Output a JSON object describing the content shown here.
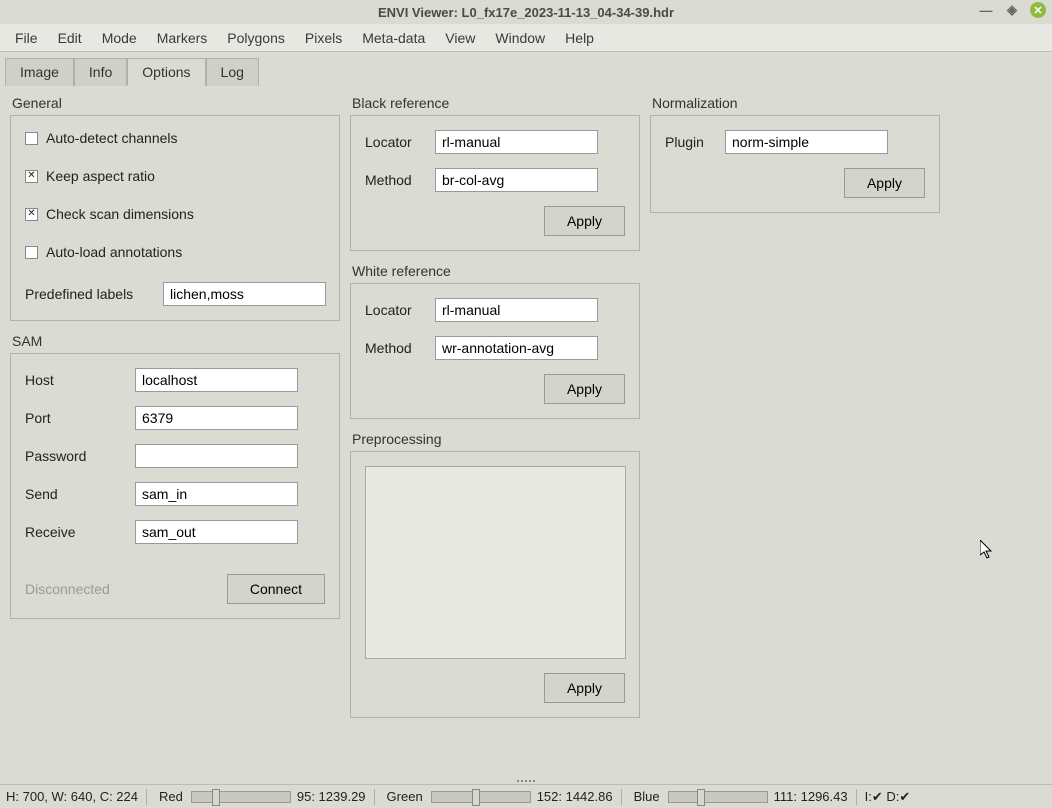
{
  "window": {
    "title": "ENVI Viewer: L0_fx17e_2023-11-13_04-34-39.hdr"
  },
  "menu": [
    "File",
    "Edit",
    "Mode",
    "Markers",
    "Polygons",
    "Pixels",
    "Meta-data",
    "View",
    "Window",
    "Help"
  ],
  "tabs": {
    "image": "Image",
    "info": "Info",
    "options": "Options",
    "log": "Log",
    "active": "options"
  },
  "general": {
    "title": "General",
    "auto_detect": {
      "label": "Auto-detect channels",
      "checked": false
    },
    "aspect": {
      "label": "Keep aspect ratio",
      "checked": true
    },
    "scan": {
      "label": "Check scan dimensions",
      "checked": true
    },
    "auto_load": {
      "label": "Auto-load annotations",
      "checked": false
    },
    "predef_label": "Predefined labels",
    "predef_value": "lichen,moss"
  },
  "sam": {
    "title": "SAM",
    "host_label": "Host",
    "host": "localhost",
    "port_label": "Port",
    "port": "6379",
    "password_label": "Password",
    "password": "",
    "send_label": "Send",
    "send": "sam_in",
    "receive_label": "Receive",
    "receive": "sam_out",
    "status": "Disconnected",
    "connect": "Connect"
  },
  "blackref": {
    "title": "Black reference",
    "locator_label": "Locator",
    "locator": "rl-manual",
    "method_label": "Method",
    "method": "br-col-avg",
    "apply": "Apply"
  },
  "whiteref": {
    "title": "White reference",
    "locator_label": "Locator",
    "locator": "rl-manual",
    "method_label": "Method",
    "method": "wr-annotation-avg",
    "apply": "Apply"
  },
  "preproc": {
    "title": "Preprocessing",
    "apply": "Apply"
  },
  "norm": {
    "title": "Normalization",
    "plugin_label": "Plugin",
    "plugin": "norm-simple",
    "apply": "Apply"
  },
  "status": {
    "dims": "H: 700, W: 640, C: 224",
    "red": {
      "label": "Red",
      "val": "95: 1239.29",
      "pos": 20
    },
    "green": {
      "label": "Green",
      "val": "152: 1442.86",
      "pos": 40
    },
    "blue": {
      "label": "Blue",
      "val": "111: 1296.43",
      "pos": 28
    },
    "id": "I:✔ D:✔"
  }
}
